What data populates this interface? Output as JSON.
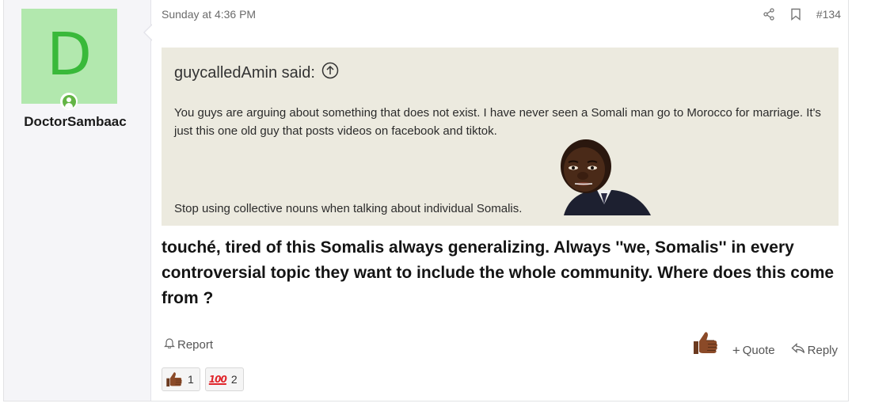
{
  "user": {
    "avatar_letter": "D",
    "name": "DoctorSambaac",
    "status": "online",
    "avatar_color": "#b2e8ae",
    "avatar_letter_color": "#39b93a"
  },
  "post": {
    "date": "Sunday at 4:36 PM",
    "number": "#134",
    "icons": [
      "share-icon",
      "bookmark-icon"
    ]
  },
  "quote": {
    "author_said": "guycalledAmin said:",
    "paragraph1": "You guys are arguing about something that does not exist. I have never seen a Somali man go to Morocco for marriage. It's just this one old guy that posts videos on facebook and tiktok.",
    "paragraph2": "Stop using collective nouns when talking about individual Somalis.",
    "background": "#eceadf"
  },
  "message": {
    "text": "touché, tired of this Somalis always generalizing. Always ''we, Somalis'' in every controversial topic they want to include the whole community. Where does this come from ?"
  },
  "actions": {
    "report": "Report",
    "quote": "Quote",
    "reply": "Reply"
  },
  "reactions": [
    {
      "icon": "thumbs-up-icon",
      "count": "1"
    },
    {
      "icon": "hundred-points-icon",
      "label": "100",
      "count": "2"
    }
  ]
}
